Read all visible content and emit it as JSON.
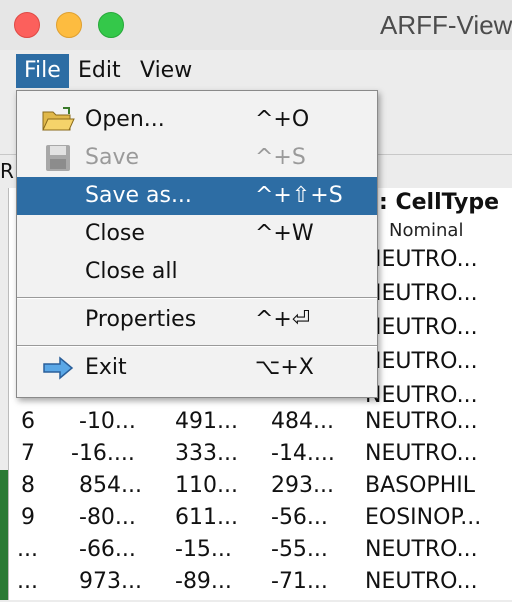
{
  "window": {
    "title": "ARFF-Viewe"
  },
  "menubar": {
    "items": [
      "File",
      "Edit",
      "View"
    ]
  },
  "tab_stub": "R",
  "file_menu": {
    "items": [
      {
        "label": "Open...",
        "accel": "^+O",
        "icon": "folder-open-icon",
        "state": "enabled"
      },
      {
        "label": "Save",
        "accel": "^+S",
        "icon": "floppy-disk-icon",
        "state": "disabled"
      },
      {
        "label": "Save as...",
        "accel": "^+⇧+S",
        "icon": "",
        "state": "selected"
      },
      {
        "label": "Close",
        "accel": "^+W",
        "icon": "",
        "state": "enabled"
      },
      {
        "label": "Close all",
        "accel": "",
        "icon": "",
        "state": "enabled"
      },
      {
        "label": "Properties",
        "accel": "^+⏎",
        "icon": "",
        "state": "enabled"
      },
      {
        "label": "Exit",
        "accel": "⌥+X",
        "icon": "arrow-right-icon",
        "state": "enabled"
      }
    ]
  },
  "table": {
    "visible_header": {
      "name": "CellType",
      "type": "Nominal",
      "prefix": ":"
    },
    "rows_under_menu": [
      "NEUTRO...",
      "NEUTRO...",
      "NEUTRO...",
      "NEUTRO...",
      "NEUTRO..."
    ],
    "rows": [
      [
        "6",
        "-10...",
        "491...",
        "484...",
        "NEUTRO..."
      ],
      [
        "7",
        "-16....",
        "333...",
        "-14....",
        "NEUTRO..."
      ],
      [
        "8",
        "854...",
        "110...",
        "293...",
        "BASOPHIL"
      ],
      [
        "9",
        "-80...",
        "611...",
        "-56...",
        "EOSINOP..."
      ],
      [
        "...",
        "-66...",
        "-15...",
        "-55...",
        "NEUTRO..."
      ],
      [
        "...",
        "973...",
        "-89...",
        "-71...",
        "NEUTRO..."
      ]
    ]
  },
  "colors": {
    "accent": "#2d6da4",
    "traffic_red": "#fc605c",
    "traffic_yellow": "#fdbc40",
    "traffic_green": "#34c84a"
  }
}
